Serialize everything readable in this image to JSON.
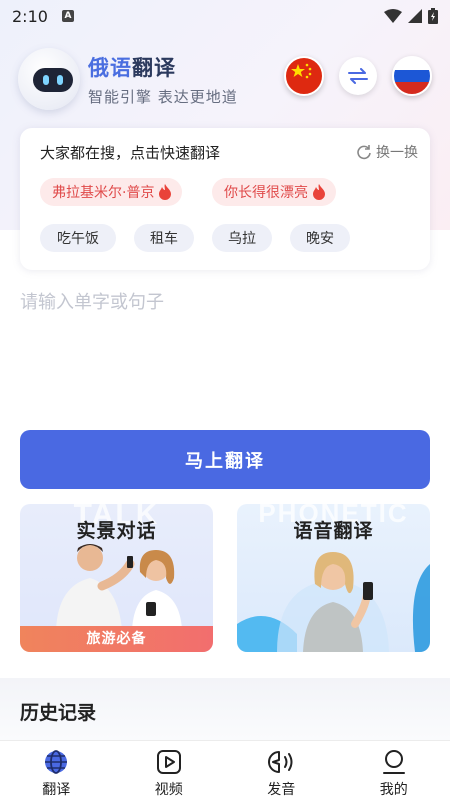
{
  "status_bar": {
    "time": "2:10",
    "app_icon": "A"
  },
  "header": {
    "title_accent": "俄语",
    "title_rest": "翻译",
    "subtitle": "智能引擎 表达更地道",
    "source_lang_icon": "china-flag-icon",
    "target_lang_icon": "russia-flag-icon",
    "swap_icon": "swap-arrows-icon"
  },
  "suggestions": {
    "title": "大家都在搜，点击快速翻译",
    "refresh_label": "换一换",
    "hot": [
      "弗拉基米尔·普京",
      "你长得很漂亮"
    ],
    "chips": [
      "吃午饭",
      "租车",
      "乌拉",
      "晚安"
    ]
  },
  "input": {
    "placeholder": "请输入单字或句子",
    "value": ""
  },
  "translate_button": {
    "label": "马上翻译"
  },
  "features": [
    {
      "title": "实景对话",
      "watermark": "TALK",
      "tag": "旅游必备"
    },
    {
      "title": "语音翻译",
      "watermark": "PHONETIC"
    }
  ],
  "history": {
    "title": "历史记录"
  },
  "tabs": [
    {
      "label": "翻译",
      "icon": "globe-icon",
      "active": true
    },
    {
      "label": "视频",
      "icon": "video-play-icon",
      "active": false
    },
    {
      "label": "发音",
      "icon": "speaker-sound-icon",
      "active": false
    },
    {
      "label": "我的",
      "icon": "profile-icon",
      "active": false
    }
  ],
  "colors": {
    "primary": "#4a69e2",
    "hot": "#e04a4a",
    "tag": "#f26e6e"
  }
}
